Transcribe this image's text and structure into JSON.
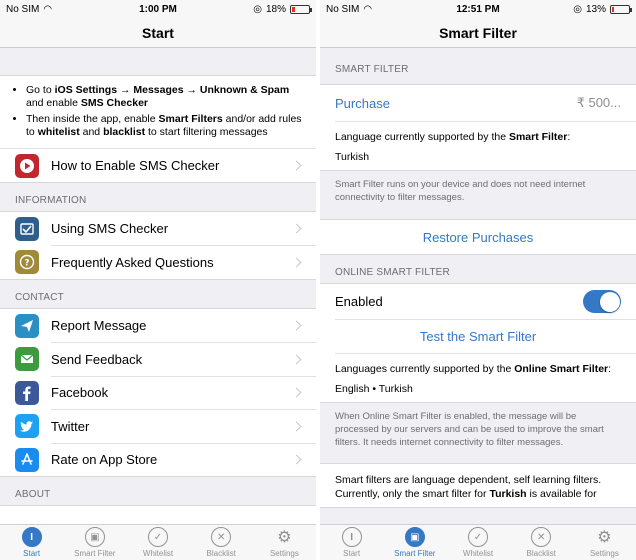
{
  "left": {
    "status": {
      "carrier": "No SIM",
      "time": "1:00 PM",
      "battery": "18%",
      "battery_level": 0.18
    },
    "title": "Start",
    "instructions": {
      "b1_pre": "Go to ",
      "b1_bold1": "iOS Settings → Messages → Unknown & Spam",
      "b1_mid": " and enable ",
      "b1_bold2": "SMS Checker",
      "b2_pre": "Then inside the app, enable ",
      "b2_bold1": "Smart Filters",
      "b2_mid": " and/or add rules to ",
      "b2_bold2": "whitelist",
      "b2_mid2": " and ",
      "b2_bold3": "blacklist",
      "b2_post": " to start filtering messages"
    },
    "how_to": {
      "label": "How to Enable SMS Checker",
      "color": "#c1272d",
      "icon": "play-icon"
    },
    "section_information": "INFORMATION",
    "information": [
      {
        "label": "Using SMS Checker",
        "color": "#2f5e8c",
        "icon": "checklist-icon"
      },
      {
        "label": "Frequently Asked Questions",
        "color": "#a08a3a",
        "icon": "question-icon"
      }
    ],
    "section_contact": "CONTACT",
    "contact": [
      {
        "label": "Report Message",
        "color": "#2a8fc2",
        "icon": "paper-plane-icon"
      },
      {
        "label": "Send Feedback",
        "color": "#3d9a3d",
        "icon": "envelope-icon"
      },
      {
        "label": "Facebook",
        "color": "#3b5998",
        "icon": "facebook-icon"
      },
      {
        "label": "Twitter",
        "color": "#1da1f2",
        "icon": "twitter-icon"
      },
      {
        "label": "Rate on App Store",
        "color": "#1a8cf0",
        "icon": "app-store-icon"
      }
    ],
    "section_about": "ABOUT",
    "active_tab": 0
  },
  "right": {
    "status": {
      "carrier": "No SIM",
      "time": "12:51 PM",
      "battery": "13%",
      "battery_level": 0.13
    },
    "title": "Smart Filter",
    "section_smart": "SMART FILTER",
    "purchase_label": "Purchase",
    "purchase_price": "₹ 500...",
    "lang_pre": "Language currently supported by the ",
    "lang_bold": "Smart Filter",
    "lang_post": ":",
    "lang_value": "Turkish",
    "footer1": "Smart Filter runs on your device and does not need internet connectivity to filter messages.",
    "restore": "Restore Purchases",
    "section_online": "ONLINE SMART FILTER",
    "enabled_label": "Enabled",
    "enabled": true,
    "test": "Test the Smart Filter",
    "online_lang_pre": "Languages currently supported by the ",
    "online_lang_bold": "Online Smart Filter",
    "online_lang_post": ":",
    "online_lang_value": "English • Turkish",
    "footer2": "When Online Smart Filter is enabled, the message will be processed by our servers and can be used to improve the smart filters. It needs internet connectivity to filter messages.",
    "bottom_pre": "Smart filters are language dependent, self learning filters. Currently, only the smart filter for ",
    "bottom_bold": "Turkish",
    "bottom_post": " is available for",
    "active_tab": 1
  },
  "tabs": [
    {
      "label": "Start",
      "icon": "start-icon"
    },
    {
      "label": "Smart Filter",
      "icon": "chip-icon"
    },
    {
      "label": "Whitelist",
      "icon": "check-icon"
    },
    {
      "label": "Blacklist",
      "icon": "x-icon"
    },
    {
      "label": "Settings",
      "icon": "gear-icon"
    }
  ]
}
